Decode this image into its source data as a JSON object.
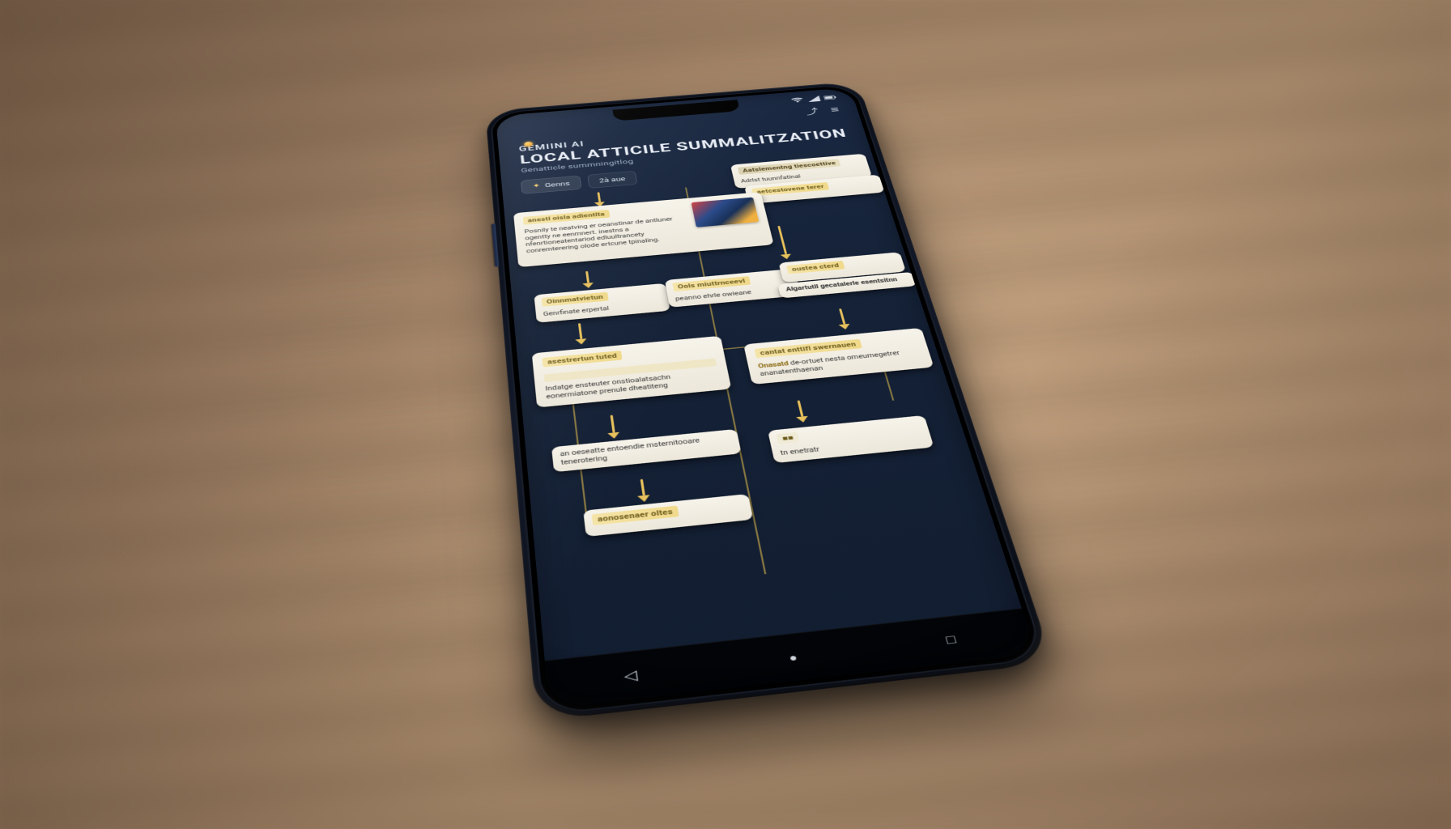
{
  "status": {
    "icons": [
      "wifi-icon",
      "signal-icon",
      "battery-icon"
    ]
  },
  "topbar": {
    "share_label": "Share",
    "menu_label": "Menu"
  },
  "header": {
    "eyebrow": "GEMIINI AI",
    "title": "LOCAL ATTICILE SUMMALITZATION",
    "subtitle": "Genatticle summningitlog"
  },
  "tabs": [
    {
      "icon": "✦",
      "label": "Genns"
    },
    {
      "icon": "",
      "label": "2à aue"
    }
  ],
  "cards": {
    "a": {
      "hd": "anestl oisla adientlta",
      "bd": "Posnily te neatving er oeanstinar de antluner ogentty ne eenmnert. inestns a nfenrtioneatentariod edluultrancety conremterering olode ertcune tpinaling."
    },
    "b": {
      "hd": "Aatslementng tiescoettive",
      "hd2": "Adrlst tuunnfatinal",
      "bd": ""
    },
    "b2": {
      "hd": "aetcestovene terer",
      "bd": ""
    },
    "c": {
      "hd": "Oinnmatvietun",
      "bd": "Genrfinate erpertal"
    },
    "d": {
      "hd": "Ools miuttrnceevl",
      "bd": "peanno ehrle owieane"
    },
    "e": {
      "hd": "oustea cterd",
      "hd2": "Algartutll gecatalerle esentsitnn",
      "bd": ""
    },
    "f": {
      "hd": "asestrertun tuted",
      "bd": "Indatge ensteuter onstioalatsachn eonermiatone prenule dheatiteng"
    },
    "g": {
      "hd": "cantat enttifl swernauen",
      "bd": "de-ortuet nesta omeurnegetrer ananatenthaenan",
      "tag": "Onasatd"
    },
    "h": {
      "hd": "",
      "bd": "an oeseatte entoendie msternitooare tenerotering"
    },
    "i": {
      "hd": "aonosenaer oltes",
      "bd": ""
    }
  },
  "nav": {
    "back": "Back",
    "home": "Home",
    "recent": "Recent"
  }
}
